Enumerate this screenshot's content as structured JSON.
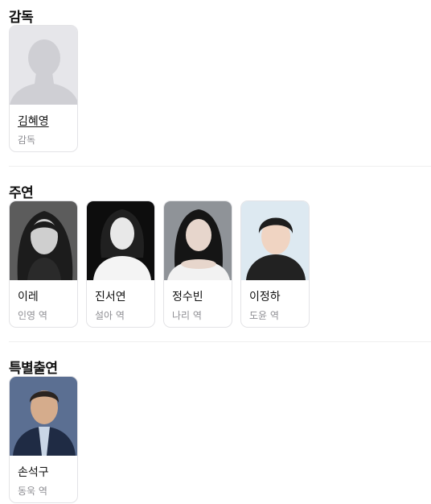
{
  "sections": [
    {
      "title": "감독",
      "people": [
        {
          "name": "김혜영",
          "role": "감독",
          "photo": "placeholder-silhouette"
        }
      ]
    },
    {
      "title": "주연",
      "people": [
        {
          "name": "이레",
          "role": "인영 역",
          "photo": "portrait"
        },
        {
          "name": "진서연",
          "role": "설아 역",
          "photo": "portrait"
        },
        {
          "name": "정수빈",
          "role": "나리 역",
          "photo": "portrait"
        },
        {
          "name": "이정하",
          "role": "도윤 역",
          "photo": "portrait"
        }
      ]
    },
    {
      "title": "특별출연",
      "people": [
        {
          "name": "손석구",
          "role": "동욱 역",
          "photo": "portrait"
        }
      ]
    }
  ],
  "colors": {
    "placeholder_bg": "#e6e6ea",
    "placeholder_figure": "#cfcfd4",
    "role_text": "#8e8e93",
    "card_border": "#e3e3e6"
  }
}
